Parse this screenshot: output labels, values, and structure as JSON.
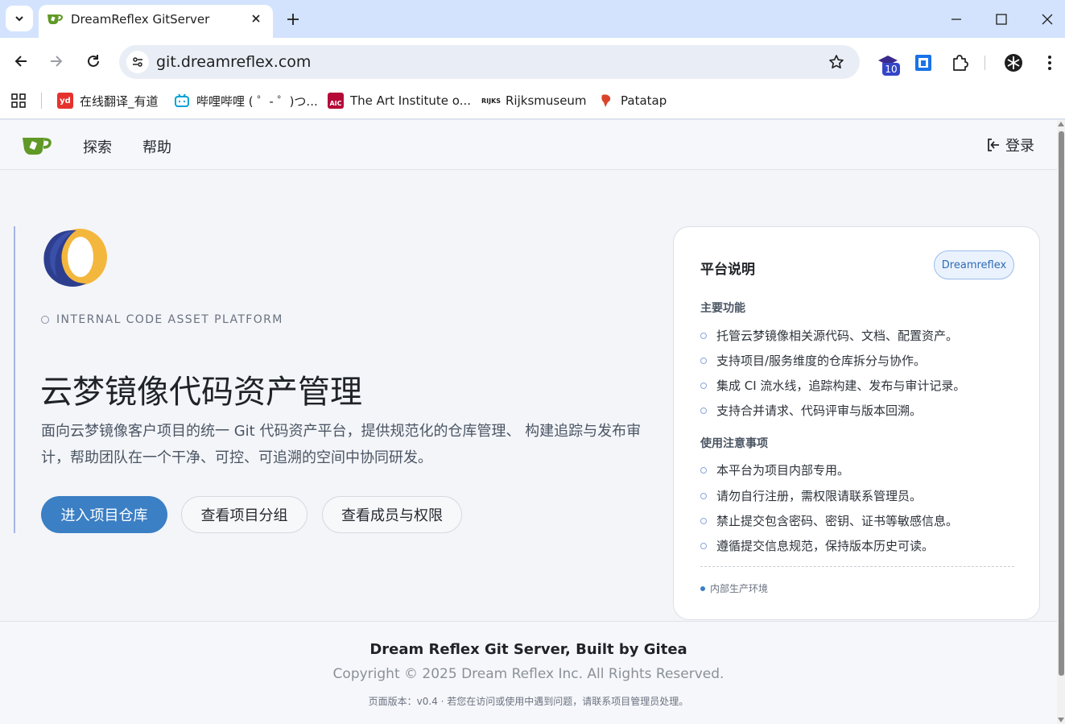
{
  "browser": {
    "tab_title": "DreamReflex GitServer",
    "url": "git.dreamreflex.com",
    "extension_badge": "10",
    "bookmarks": [
      {
        "label": "在线翻译_有道",
        "icon": "youdao-icon"
      },
      {
        "label": "哔哩哔哩 ( ゜- ゜)つ...",
        "icon": "bilibili-icon"
      },
      {
        "label": "The Art Institute o...",
        "icon": "aic-icon"
      },
      {
        "label": "Rijksmuseum",
        "icon": "rijks-icon"
      },
      {
        "label": "Patatap",
        "icon": "patatap-icon"
      }
    ]
  },
  "navbar": {
    "links": [
      "探索",
      "帮助"
    ],
    "login_label": "登录"
  },
  "hero": {
    "tagline": "INTERNAL CODE ASSET PLATFORM",
    "title": "云梦镜像代码资产管理",
    "description": "面向云梦镜像客户项目的统一 Git 代码资产平台，提供规范化的仓库管理、 构建追踪与发布审计，帮助团队在一个干净、可控、可追溯的空间中协同研发。",
    "buttons": {
      "primary": "进入项目仓库",
      "groups": "查看项目分组",
      "members": "查看成员与权限"
    }
  },
  "card": {
    "title": "平台说明",
    "badge": "Dreamreflex",
    "features_title": "主要功能",
    "features": [
      "托管云梦镜像相关源代码、文档、配置资产。",
      "支持项目/服务维度的仓库拆分与协作。",
      "集成 CI 流水线，追踪构建、发布与审计记录。",
      "支持合并请求、代码评审与版本回溯。"
    ],
    "notes_title": "使用注意事项",
    "notes": [
      "本平台为项目内部专用。",
      "请勿自行注册，需权限请联系管理员。",
      "禁止提交包含密码、密钥、证书等敏感信息。",
      "遵循提交信息规范，保持版本历史可读。"
    ],
    "env_label": "内部生产环境"
  },
  "footer": {
    "line1": "Dream Reflex Git Server, Built by Gitea",
    "line2": "Copyright © 2025 Dream Reflex Inc. All Rights Reserved.",
    "line3": "页面版本：v0.4 · 若您在访问或使用中遇到问题，请联系项目管理员处理。"
  },
  "colors": {
    "accent": "#3b7fc4",
    "annotation_arrow": "#3f4fc9",
    "tabstrip": "#d3e3fd"
  }
}
